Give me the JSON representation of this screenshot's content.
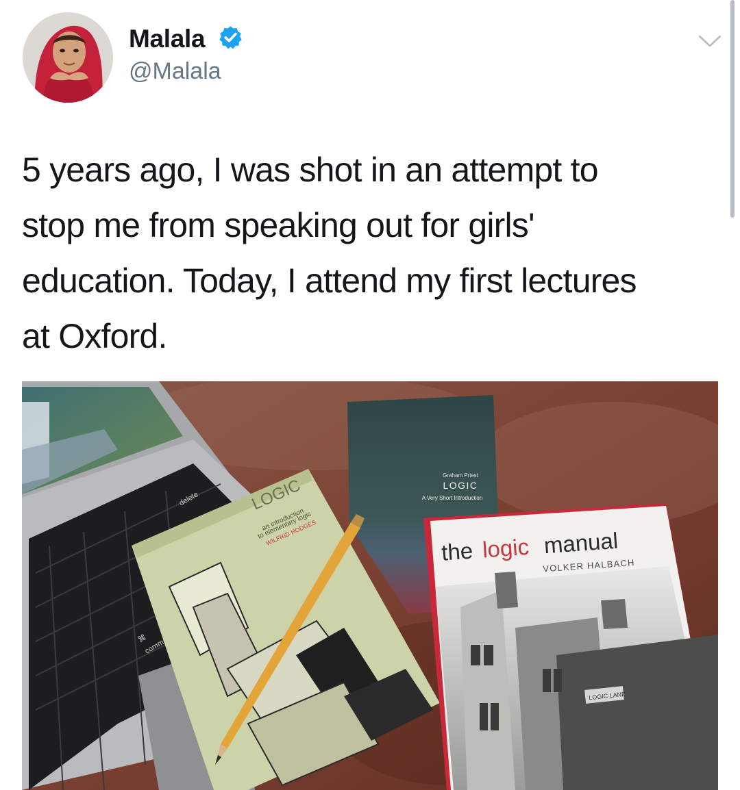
{
  "tweet": {
    "author": {
      "name": "Malala",
      "handle": "@Malala",
      "verified": true
    },
    "text_lines": [
      "5 years ago, I was shot in an attempt to",
      "stop me from speaking out for girls'",
      "education. Today, I attend my first lectures",
      "at Oxford."
    ]
  },
  "photo": {
    "books": {
      "priest": {
        "author": "Graham Priest",
        "title": "LOGIC",
        "subtitle": "A Very Short Introduction"
      },
      "hodges": {
        "title": "LOGIC",
        "subtitle_line1": "an introduction",
        "subtitle_line2": "to elementary logic",
        "author": "WILFRID HODGES"
      },
      "halbach": {
        "title_the": "the",
        "title_logic": "logic",
        "title_manual": "manual",
        "author": "VOLKER HALBACH",
        "sign": "LOGIC LANE"
      }
    },
    "keyboard": {
      "delete": "delete",
      "command": "command",
      "command_symbol": "⌘"
    }
  },
  "colors": {
    "verified_blue": "#1da1f2",
    "handle_gray": "#657786",
    "text": "#14171a",
    "logic_red": "#c8373d"
  },
  "icons": {
    "verified": "verified-badge-icon",
    "menu": "chevron-down-icon"
  }
}
